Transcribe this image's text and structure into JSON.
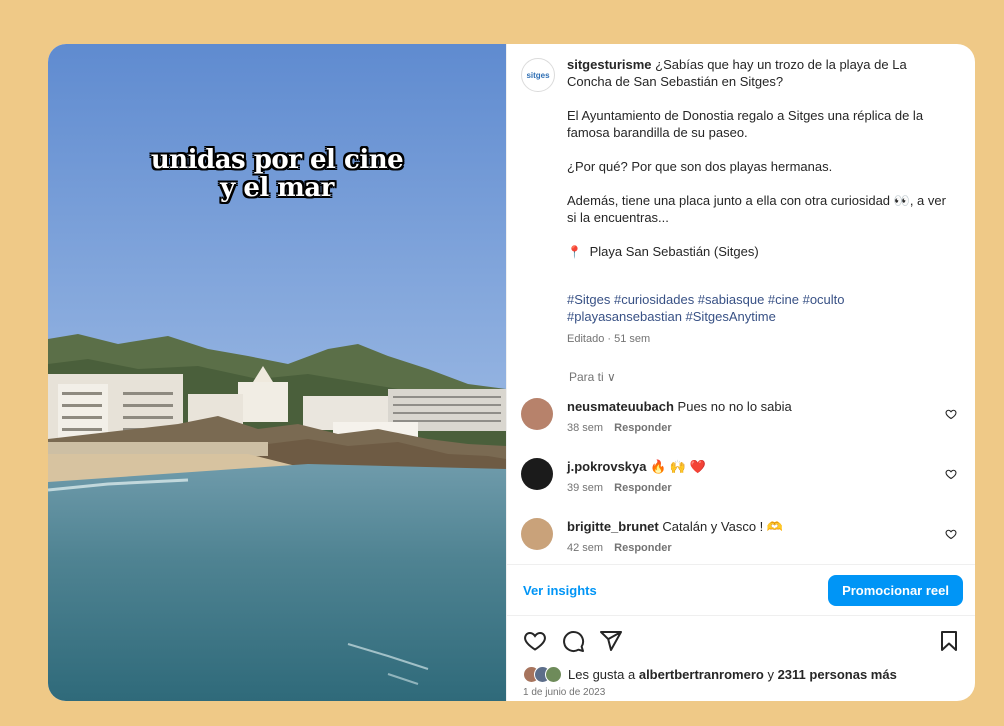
{
  "video": {
    "overlay_line1": "unidas por el cine",
    "overlay_line2": "y el mar"
  },
  "post": {
    "brand_avatar_text": "sitges",
    "username": "sitgesturisme",
    "caption_lead": "¿Sabías que hay un trozo de la playa de La Concha de San Sebastián en Sitges?",
    "paragraph2": "El Ayuntamiento de Donostia regalo a Sitges una réplica de la famosa barandilla de su paseo.",
    "paragraph3": "¿Por qué? Por que son dos playas hermanas.",
    "paragraph4": "Además, tiene una placa junto a ella con otra curiosidad 👀, a ver si la encuentras...",
    "location": "Playa San Sebastián (Sitges)",
    "hashtags": "#Sitges #curiosidades #sabiasque #cine #oculto #playasansebastian #SitgesAnytime",
    "edited": "Editado · 51 sem"
  },
  "filter_label": "Para ti ∨",
  "comments": [
    {
      "username": "neusmateuubach",
      "text": "Pues no no lo sabia",
      "time": "38 sem",
      "reply": "Responder",
      "avatar_color": "#b7826b"
    },
    {
      "username": "j.pokrovskya",
      "text": "🔥 🙌 ❤️",
      "time": "39 sem",
      "reply": "Responder",
      "avatar_color": "#1b1b1b"
    },
    {
      "username": "brigitte_brunet",
      "text": "Catalán y Vasco ! 🫶",
      "time": "42 sem",
      "reply": "Responder",
      "avatar_color": "#c9a27a"
    }
  ],
  "insights_label": "Ver insights",
  "promote_label": "Promocionar reel",
  "likes": {
    "prefix": "Les gusta a ",
    "user": "albertbertranromero",
    "middle": " y ",
    "others": "2311 personas más"
  },
  "date": "1 de junio de 2023",
  "colors": {
    "background": "#efc987",
    "accent": "#0095f6",
    "hashtag": "#385185"
  }
}
